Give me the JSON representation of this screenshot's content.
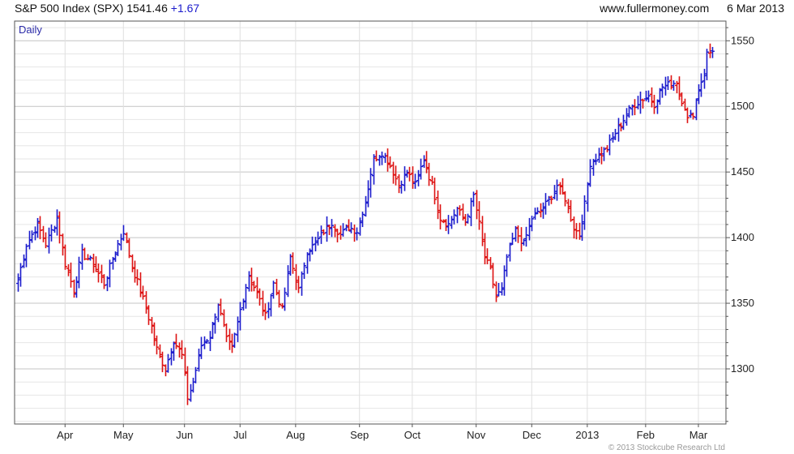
{
  "header": {
    "title": "S&P 500 Index (SPX)",
    "last": "1541.46",
    "change": "+1.67",
    "site": "www.fullermoney.com",
    "date": "6 Mar 2013"
  },
  "colors": {
    "up": "#1a1acc",
    "down": "#dd1111",
    "grid": "#d4d4d4",
    "frame": "#555555",
    "text": "#222222",
    "period_label": "#2a2aa8"
  },
  "chart_data": {
    "type": "ohlc",
    "period_label": "Daily",
    "ylim": [
      1258,
      1565
    ],
    "y_ticks": [
      1300,
      1350,
      1400,
      1450,
      1500,
      1550
    ],
    "y_axis_side": "right",
    "grid": true,
    "x_range": [
      0,
      252
    ],
    "month_ticks": [
      {
        "label": "Apr",
        "x": 17
      },
      {
        "label": "May",
        "x": 38
      },
      {
        "label": "Jun",
        "x": 60
      },
      {
        "label": "Jul",
        "x": 80
      },
      {
        "label": "Aug",
        "x": 100
      },
      {
        "label": "Sep",
        "x": 123
      },
      {
        "label": "Oct",
        "x": 142
      },
      {
        "label": "Nov",
        "x": 165
      },
      {
        "label": "Dec",
        "x": 185
      },
      {
        "label": "2013",
        "x": 205
      },
      {
        "label": "Feb",
        "x": 226
      },
      {
        "label": "Mar",
        "x": 245
      }
    ],
    "close_waypoints": [
      [
        0,
        1368
      ],
      [
        3,
        1395
      ],
      [
        7,
        1410
      ],
      [
        10,
        1395
      ],
      [
        14,
        1415
      ],
      [
        17,
        1380
      ],
      [
        20,
        1360
      ],
      [
        23,
        1388
      ],
      [
        27,
        1380
      ],
      [
        31,
        1365
      ],
      [
        35,
        1390
      ],
      [
        38,
        1405
      ],
      [
        41,
        1378
      ],
      [
        44,
        1360
      ],
      [
        48,
        1332
      ],
      [
        50,
        1315
      ],
      [
        53,
        1300
      ],
      [
        56,
        1322
      ],
      [
        59,
        1310
      ],
      [
        61,
        1278
      ],
      [
        63,
        1290
      ],
      [
        66,
        1318
      ],
      [
        69,
        1325
      ],
      [
        72,
        1350
      ],
      [
        75,
        1322
      ],
      [
        77,
        1315
      ],
      [
        80,
        1345
      ],
      [
        83,
        1372
      ],
      [
        86,
        1358
      ],
      [
        89,
        1340
      ],
      [
        92,
        1365
      ],
      [
        95,
        1345
      ],
      [
        98,
        1385
      ],
      [
        101,
        1360
      ],
      [
        104,
        1390
      ],
      [
        107,
        1395
      ],
      [
        110,
        1405
      ],
      [
        113,
        1412
      ],
      [
        116,
        1402
      ],
      [
        119,
        1408
      ],
      [
        122,
        1405
      ],
      [
        125,
        1428
      ],
      [
        128,
        1460
      ],
      [
        131,
        1465
      ],
      [
        134,
        1455
      ],
      [
        137,
        1440
      ],
      [
        140,
        1450
      ],
      [
        143,
        1440
      ],
      [
        146,
        1460
      ],
      [
        149,
        1440
      ],
      [
        152,
        1415
      ],
      [
        155,
        1410
      ],
      [
        158,
        1422
      ],
      [
        161,
        1412
      ],
      [
        164,
        1432
      ],
      [
        166,
        1410
      ],
      [
        168,
        1385
      ],
      [
        170,
        1375
      ],
      [
        172,
        1355
      ],
      [
        174,
        1360
      ],
      [
        176,
        1385
      ],
      [
        179,
        1405
      ],
      [
        182,
        1395
      ],
      [
        185,
        1415
      ],
      [
        188,
        1420
      ],
      [
        191,
        1428
      ],
      [
        194,
        1440
      ],
      [
        197,
        1430
      ],
      [
        200,
        1408
      ],
      [
        202,
        1402
      ],
      [
        204,
        1425
      ],
      [
        206,
        1457
      ],
      [
        209,
        1462
      ],
      [
        212,
        1468
      ],
      [
        215,
        1480
      ],
      [
        218,
        1490
      ],
      [
        221,
        1500
      ],
      [
        224,
        1505
      ],
      [
        227,
        1508
      ],
      [
        229,
        1502
      ],
      [
        232,
        1515
      ],
      [
        235,
        1517
      ],
      [
        237,
        1519
      ],
      [
        238,
        1510
      ],
      [
        240,
        1500
      ],
      [
        241,
        1490
      ],
      [
        243,
        1495
      ],
      [
        245,
        1514
      ],
      [
        247,
        1525
      ],
      [
        248,
        1540
      ],
      [
        250,
        1542
      ]
    ]
  },
  "copyright": "© 2013 Stockcube Research Ltd"
}
